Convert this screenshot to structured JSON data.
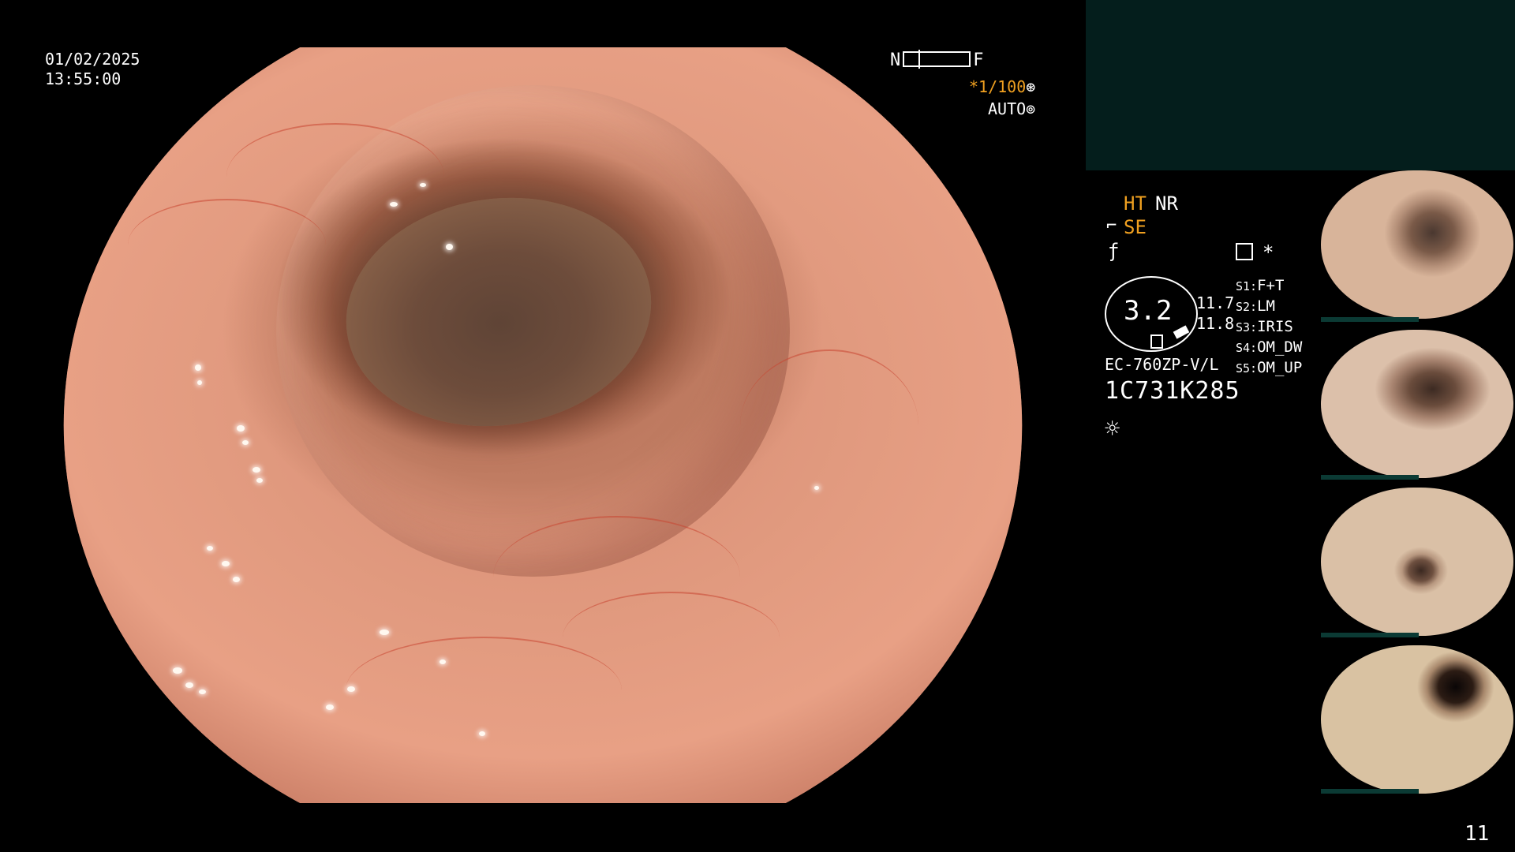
{
  "overlay": {
    "date": "01/02/2025",
    "time": "13:55:00",
    "near_label": "N",
    "far_label": "F",
    "shutter": "*1/100",
    "auto": "AUTO"
  },
  "status": {
    "ht": "HT",
    "nr": "NR",
    "se": "SE",
    "gauge_value": "3.2",
    "value_1": "11.7",
    "value_2": "11.8",
    "star": "*",
    "slots": [
      {
        "key": "S1:",
        "value": "F+T"
      },
      {
        "key": "S2:",
        "value": "LM"
      },
      {
        "key": "S3:",
        "value": "IRIS"
      },
      {
        "key": "S4:",
        "value": "OM_DW"
      },
      {
        "key": "S5:",
        "value": "OM_UP"
      }
    ],
    "scope_model": "EC-760ZP-V/L",
    "serial": "1C731K285"
  },
  "page_number": "11",
  "icons": {
    "shutter": "aperture-icon",
    "auto": "iris-icon",
    "se": "structure-enhance-icon",
    "f": "freeze-icon",
    "grid": "grid-icon",
    "light": "light-icon"
  },
  "colors": {
    "accent": "#f0a020",
    "panel": "#041e1c"
  }
}
